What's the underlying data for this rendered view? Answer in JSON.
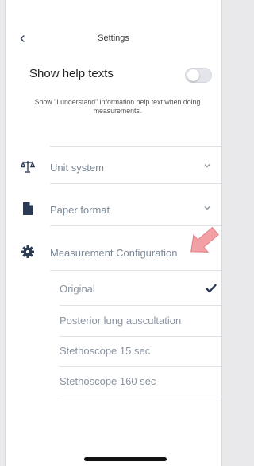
{
  "header": {
    "title": "Settings"
  },
  "help": {
    "label": "Show help texts",
    "enabled": false,
    "description": "Show \"I understand\" information help text when doing measurements."
  },
  "settings": {
    "unit_system": "Unit system",
    "paper_format": "Paper format",
    "measurement_configuration": "Measurement Configuration"
  },
  "measurement_options": [
    {
      "label": "Original",
      "selected": true
    },
    {
      "label": "Posterior lung auscultation",
      "selected": false
    },
    {
      "label": "Stethoscope 15 sec",
      "selected": false
    },
    {
      "label": "Stethoscope 160 sec",
      "selected": false
    }
  ],
  "colors": {
    "accent": "#2b3a55",
    "muted_text": "#7b8796",
    "annotation_arrow": "#f2a0a4"
  },
  "icons": {
    "back": "chevron-left-icon",
    "unit_system": "scales-icon",
    "paper_format": "document-icon",
    "measurement_configuration": "gear-icon",
    "expand": "chevron-down-icon",
    "selected": "checkmark-icon"
  }
}
